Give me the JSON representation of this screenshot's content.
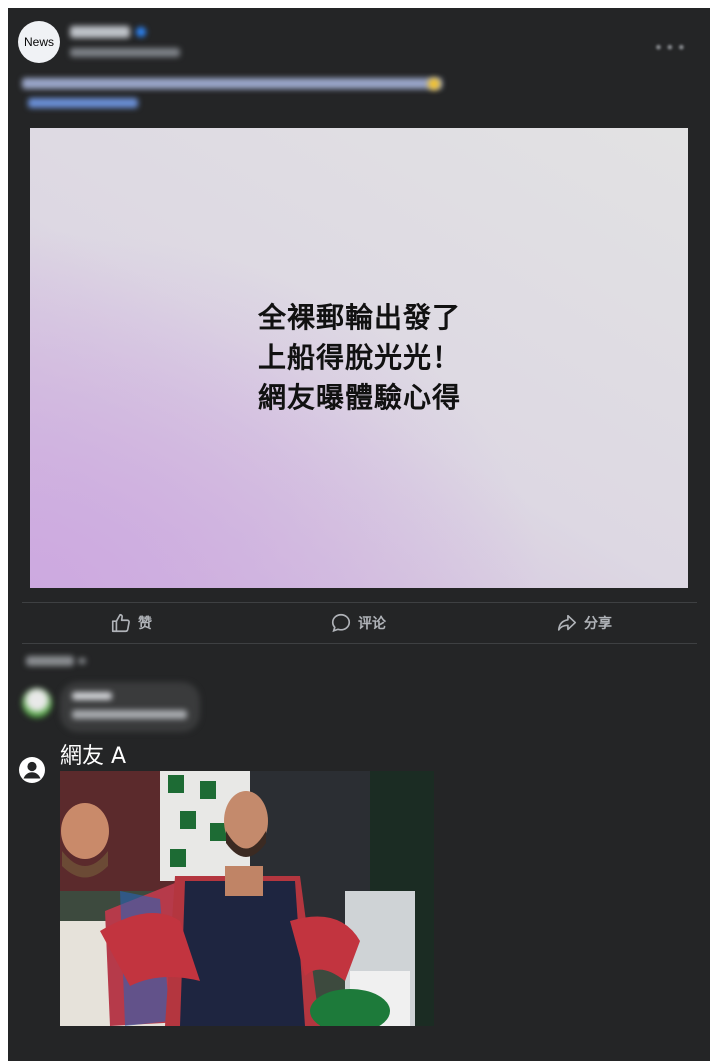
{
  "post": {
    "avatar_label": "News",
    "headline_lines": [
      "全裸郵輪出發了",
      "上船得脫光光！",
      "網友曝體驗心得"
    ]
  },
  "actions": {
    "like_label": "赞",
    "comment_label": "评论",
    "share_label": "分享"
  },
  "comment": {
    "author": "網友 A"
  },
  "colors": {
    "panel": "#242526",
    "text": "#e4e6eb",
    "secondary": "#b0b3b8",
    "accent": "#2d88ff"
  },
  "icons": {
    "more": "more-icon",
    "like": "thumbs-up-icon",
    "comment": "comment-bubble-icon",
    "share": "share-arrow-icon",
    "user": "user-icon"
  }
}
